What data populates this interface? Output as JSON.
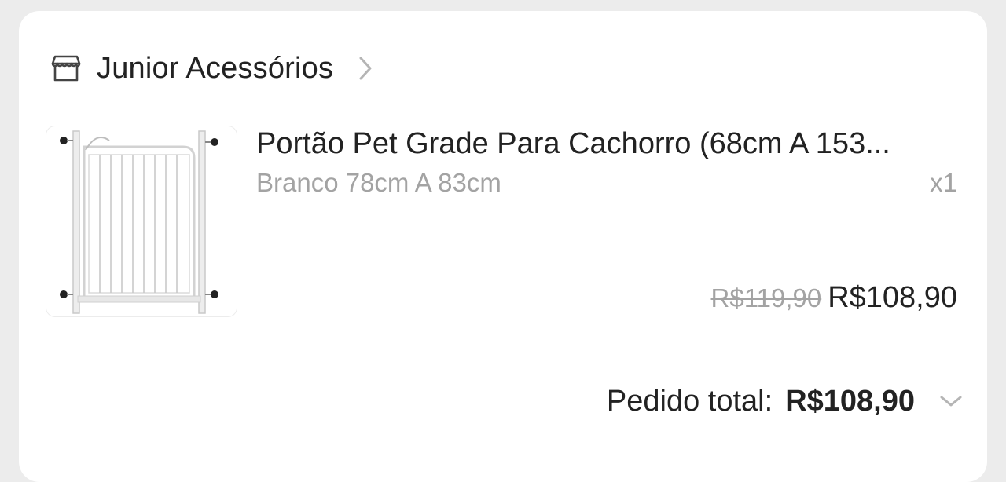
{
  "store": {
    "icon": "store-icon",
    "name": "Junior Acessórios",
    "chevron_icon": "chevron-right-icon"
  },
  "product": {
    "image": "pet-gate-image",
    "title": "Portão Pet Grade Para Cachorro (68cm A 153...",
    "variant": "Branco 78cm A 83cm",
    "quantity": "x1",
    "original_price": "R$119,90",
    "price": "R$108,90"
  },
  "order_total": {
    "label": "Pedido total:",
    "value": "R$108,90",
    "chevron_icon": "chevron-down-icon"
  },
  "colors": {
    "text": "#222222",
    "muted": "#a3a3a3",
    "background": "#ececec",
    "card": "#ffffff"
  }
}
